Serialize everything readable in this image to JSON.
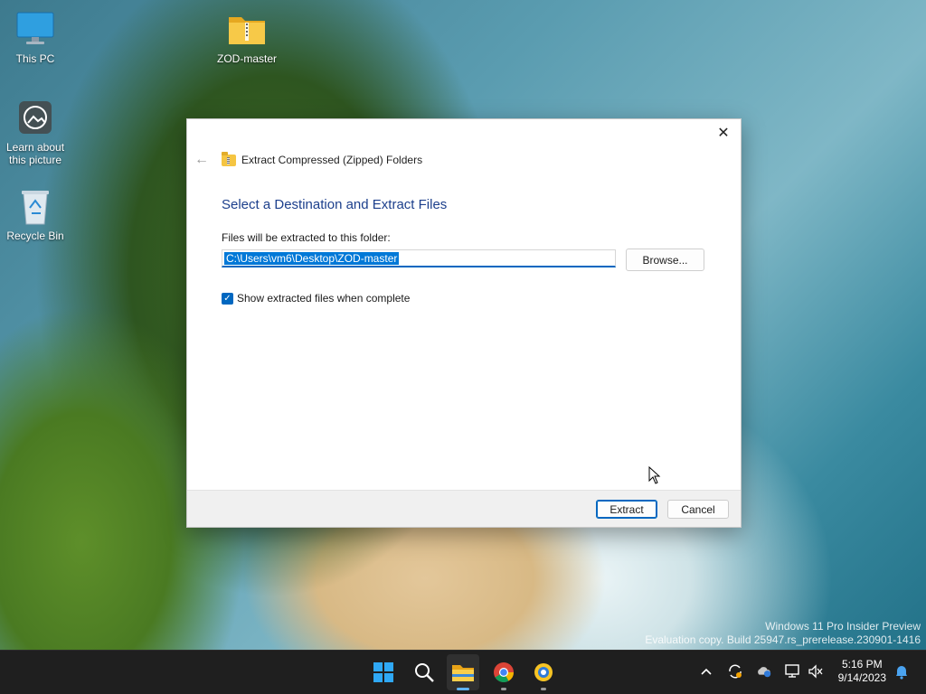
{
  "desktop": {
    "icons": [
      {
        "label": "This PC",
        "icon": "monitor-icon"
      },
      {
        "label": "ZOD-master",
        "icon": "zip-folder-icon"
      },
      {
        "label_line1": "Learn about",
        "label_line2": "this picture",
        "icon": "camera-icon"
      },
      {
        "label": "Recycle Bin",
        "icon": "recycle-bin-icon"
      }
    ],
    "watermark_line1": "Windows 11 Pro Insider Preview",
    "watermark_line2": "Evaluation copy. Build 25947.rs_prerelease.230901-1416"
  },
  "dialog": {
    "header_title": "Extract Compressed (Zipped) Folders",
    "heading": "Select a Destination and Extract Files",
    "field_label": "Files will be extracted to this folder:",
    "path_value": "C:\\Users\\vm6\\Desktop\\ZOD-master",
    "browse_label": "Browse...",
    "checkbox_label": "Show extracted files when complete",
    "checkbox_checked": true,
    "extract_label": "Extract",
    "cancel_label": "Cancel",
    "close_symbol": "✕",
    "back_symbol": "←"
  },
  "taskbar": {
    "apps": [
      "windows-start-icon",
      "search-icon",
      "file-explorer-icon",
      "chrome-icon",
      "canary-icon"
    ],
    "time": "5:16 PM",
    "date": "9/14/2023"
  },
  "colors": {
    "accent": "#0067c0",
    "heading": "#1c3f8c",
    "taskbar": "#1f1f1f"
  }
}
